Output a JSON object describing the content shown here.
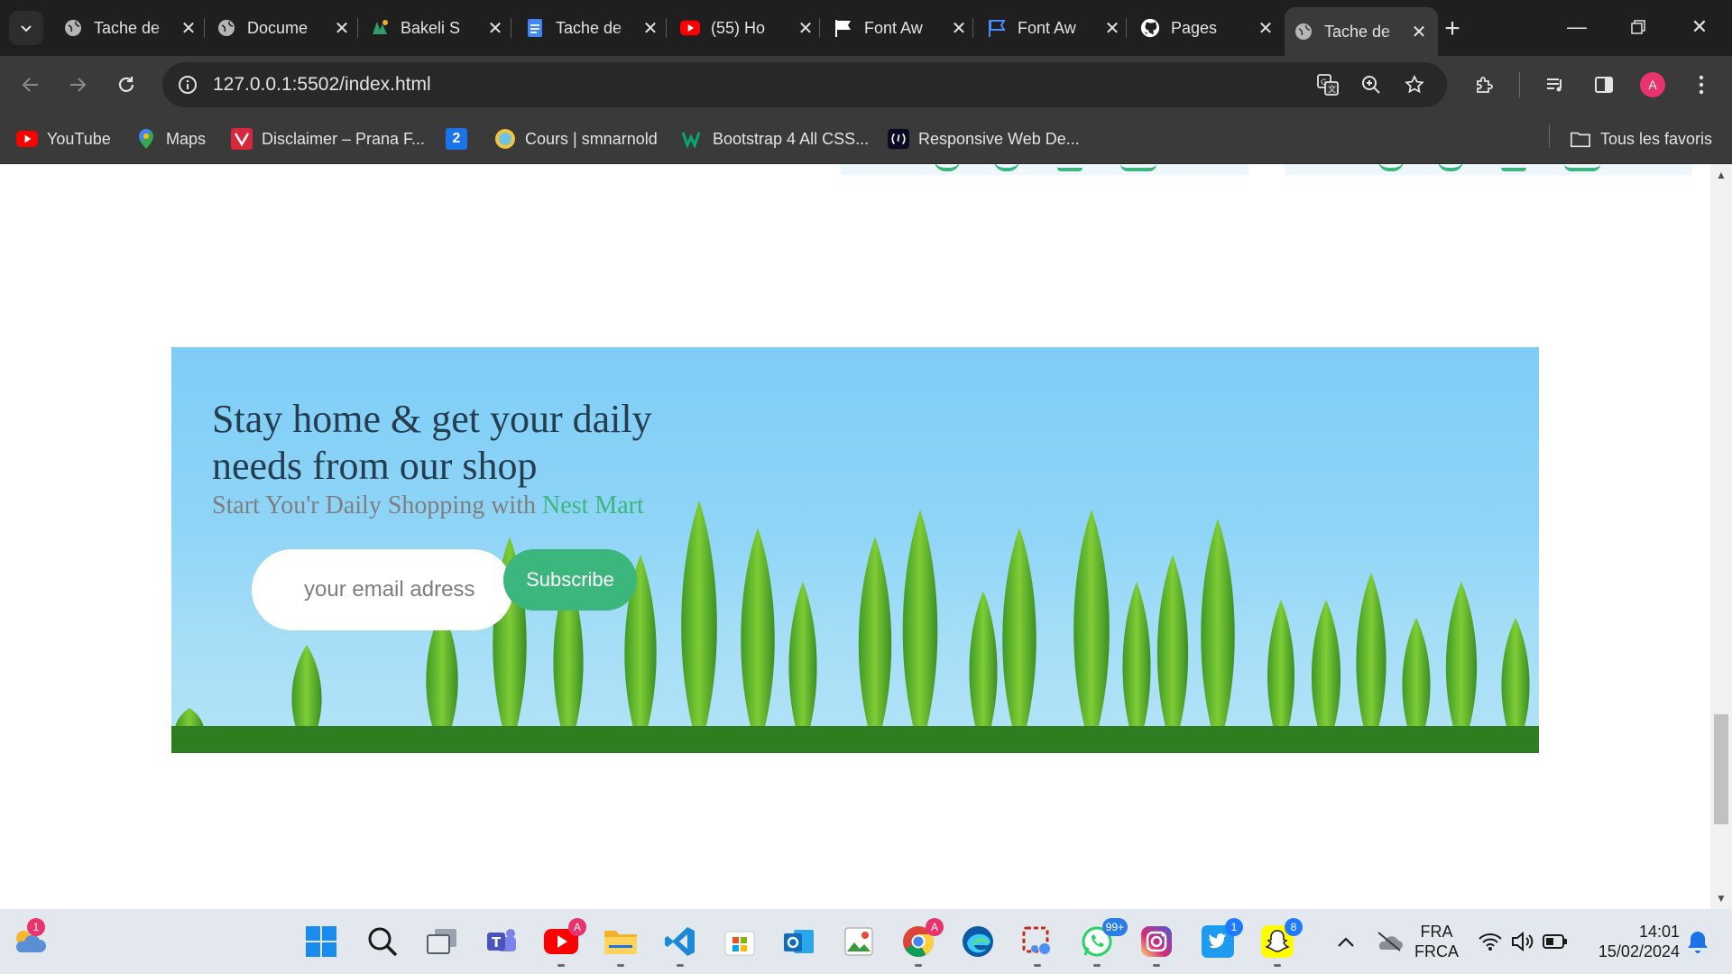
{
  "browser": {
    "tabs": [
      {
        "title": "Tache de",
        "icon": "globe-icon"
      },
      {
        "title": "Docume",
        "icon": "globe-icon"
      },
      {
        "title": "Bakeli S",
        "icon": "bakeli-icon"
      },
      {
        "title": "Tache de",
        "icon": "docs-icon"
      },
      {
        "title": "(55) Ho",
        "icon": "youtube-icon"
      },
      {
        "title": "Font Aw",
        "icon": "flag-icon"
      },
      {
        "title": "Font Aw",
        "icon": "flag-outline-icon"
      },
      {
        "title": "Pages",
        "icon": "github-icon"
      },
      {
        "title": "Tache de",
        "icon": "globe-icon",
        "active": true
      }
    ],
    "address": "127.0.0.1:5502/index.html",
    "profile_initial": "A",
    "bookmarks": [
      {
        "label": "YouTube",
        "icon": "youtube-icon"
      },
      {
        "label": "Maps",
        "icon": "maps-pin-icon"
      },
      {
        "label": "Disclaimer – Prana F...",
        "icon": "prana-icon"
      },
      {
        "label": "2",
        "icon": "calendar-icon"
      },
      {
        "label": "Cours | smnarnold",
        "icon": "smnarnold-icon"
      },
      {
        "label": "Bootstrap 4 All CSS...",
        "icon": "w3-icon"
      },
      {
        "label": "Responsive Web De...",
        "icon": "freecodecamp-icon"
      }
    ],
    "all_bookmarks_label": "Tous les favoris"
  },
  "page": {
    "banner_title": "Stay home & get your daily needs from our shop",
    "banner_subtitle_prefix": "Start You'r Daily Shopping with",
    "banner_subtitle_brand": "Nest Mart",
    "email_placeholder": "your email adress",
    "subscribe_label": "Subscribe"
  },
  "taskbar": {
    "weather_badge": "1",
    "youtube_badge": "A",
    "chrome_badge": "A",
    "whatsapp_badge": "99+",
    "twitter_badge": "1",
    "snapchat_badge": "8",
    "language_line1": "FRA",
    "language_line2": "FRCA",
    "time": "14:01",
    "date": "15/02/2024"
  },
  "colors": {
    "brand_green": "#3bb77e",
    "heading": "#253d4e",
    "muted": "#7e7e7e",
    "chrome_dark": "#1f1f1f",
    "chrome_toolbar": "#3a3a3a"
  }
}
